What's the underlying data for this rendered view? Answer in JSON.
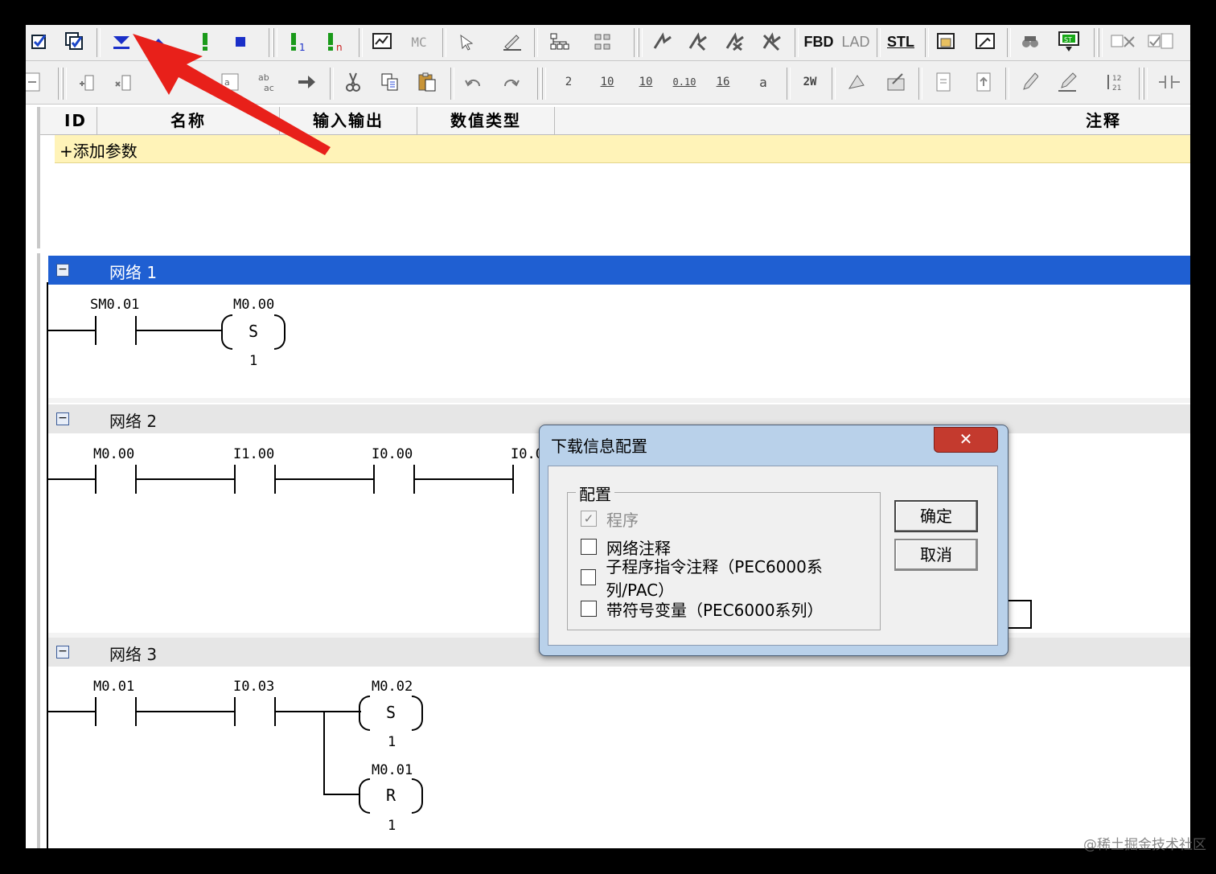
{
  "toolbar1": {
    "icons": [
      "check-program-icon",
      "check-all-icon",
      "download-icon",
      "upload-icon",
      "run-icon",
      "stop-icon",
      "run-single-icon",
      "run-n-icon",
      "monitor-icon",
      "mc-icon",
      "cursor-icon",
      "pen-icon",
      "tree-icon",
      "network-icon",
      "contact-icon",
      "contact-toggle-icon",
      "contact-x-icon",
      "contact-xx-icon"
    ],
    "fbd_label": "FBD",
    "lad_label": "LAD",
    "stl_label": "STL"
  },
  "toolbar2": {
    "icons": [
      "collapse-icon",
      "insert-row-icon",
      "delete-row-icon",
      "paste-special-icon",
      "find-icon",
      "replace-icon",
      "goto-icon",
      "cut-icon",
      "copy-icon",
      "paste-icon",
      "undo-icon",
      "redo-icon",
      "base2-icon",
      "base10-icon",
      "signed10-icon",
      "float-icon",
      "base16-icon",
      "ascii-icon",
      "word-icon",
      "force-icon",
      "unforce-icon",
      "doc-icon",
      "doc-export-icon",
      "edit-icon",
      "edit2-icon",
      "sort-icon",
      "contact-no-icon"
    ]
  },
  "vartable": {
    "col_id": "ID",
    "col_name": "名称",
    "col_io": "输入输出",
    "col_type": "数值类型",
    "col_comment": "注释",
    "add_param": "+添加参数"
  },
  "networks": [
    {
      "title": "网络 1",
      "contact1": "SM0.01",
      "coil_addr": "M0.00",
      "coil_type": "S",
      "coil_num": "1"
    },
    {
      "title": "网络 2",
      "contacts": [
        "M0.00",
        "I1.00",
        "I0.00",
        "I0.0"
      ]
    },
    {
      "title": "网络 3",
      "contacts": [
        "M0.01",
        "I0.03"
      ],
      "coil1_addr": "M0.02",
      "coil1_type": "S",
      "coil1_num": "1",
      "coil2_addr": "M0.01",
      "coil2_type": "R",
      "coil2_num": "1"
    }
  ],
  "dialog": {
    "title": "下载信息配置",
    "close": "✕",
    "group_label": "配置",
    "opt_program": "程序",
    "opt_network_comment": "网络注释",
    "opt_sub_comment": "子程序指令注释（PEC6000系列/PAC）",
    "opt_symbol_var": "带符号变量（PEC6000系列）",
    "ok": "确定",
    "cancel": "取消",
    "program_checked": true
  },
  "colors": {
    "active_header": "#1f5fd2",
    "arrow": "#e8201a",
    "dialog_frame": "#b9d1ea",
    "add_row": "#fff3b8"
  },
  "watermark": "@稀土掘金技术社区"
}
